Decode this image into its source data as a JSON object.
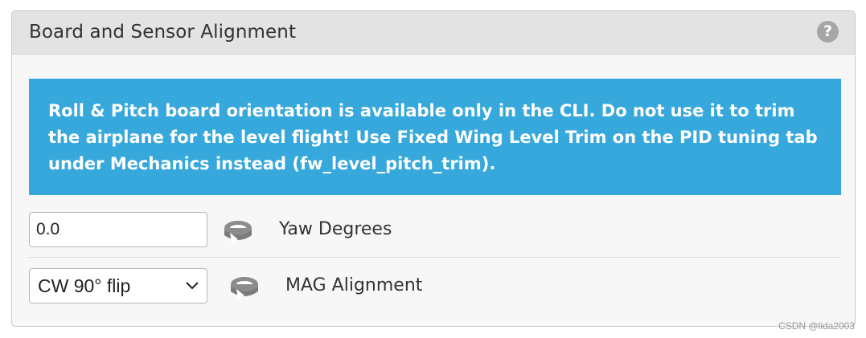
{
  "panel": {
    "title": "Board and Sensor Alignment",
    "help_icon": "question-icon"
  },
  "notice": {
    "text_before": "Roll & Pitch board orientation is available only in the CLI. Do not use it to trim the airplane for the level flight! Use Fixed Wing Level Trim on the PID tuning tab under Mechanics instead (",
    "code": "fw_level_pitch_trim",
    "text_after": ").",
    "background_color": "#37a8db"
  },
  "yaw": {
    "value": "0.0",
    "icon": "rotate-icon",
    "label": "Yaw Degrees"
  },
  "mag": {
    "selected": "CW 90° flip",
    "icon": "rotate-icon",
    "label": "MAG Alignment"
  },
  "watermark": "CSDN @lida2003"
}
